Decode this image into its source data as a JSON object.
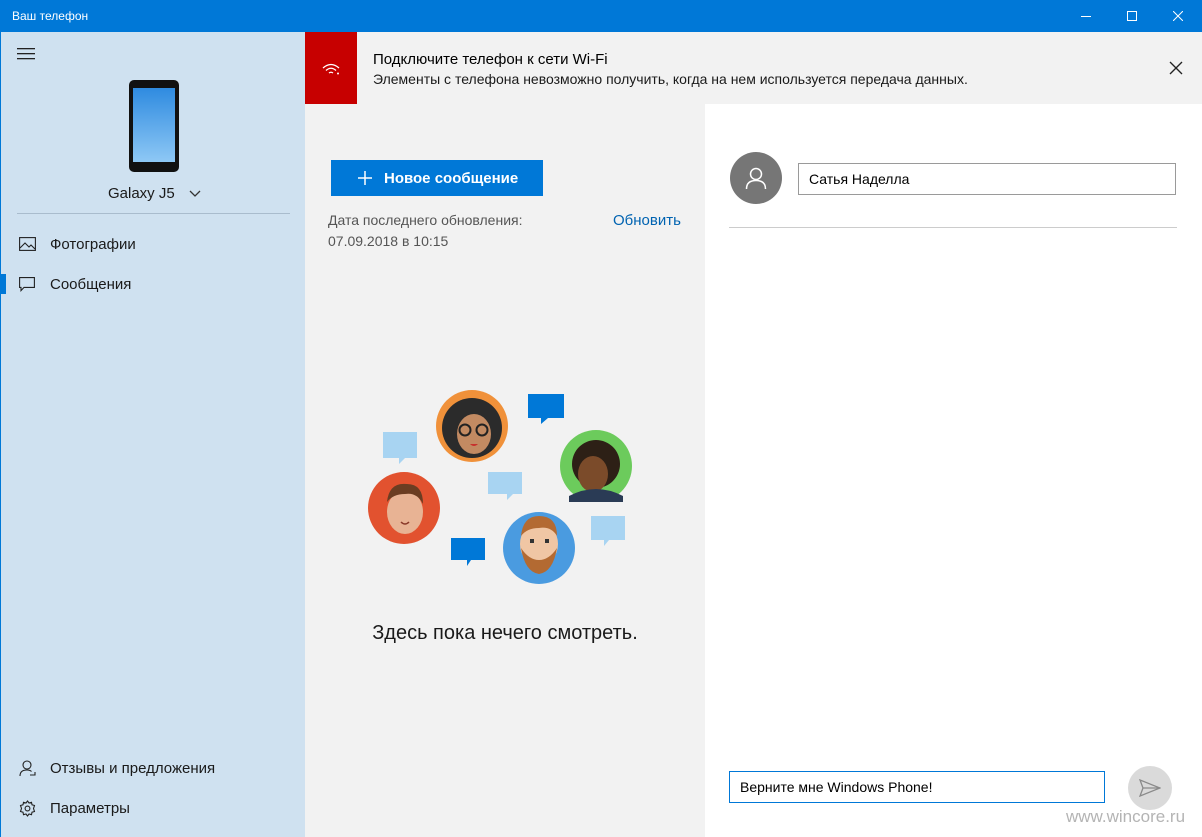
{
  "window": {
    "title": "Ваш телефон"
  },
  "sidebar": {
    "device_name": "Galaxy J5",
    "items": [
      {
        "label": "Фотографии",
        "icon": "photos-icon"
      },
      {
        "label": "Сообщения",
        "icon": "messages-icon",
        "active": true
      }
    ],
    "bottom_items": [
      {
        "label": "Отзывы и предложения",
        "icon": "feedback-icon"
      },
      {
        "label": "Параметры",
        "icon": "settings-icon"
      }
    ]
  },
  "banner": {
    "title": "Подключите телефон к сети Wi-Fi",
    "text": "Элементы с телефона невозможно получить, когда на нем используется передача данных.",
    "icon": "wifi-warning-icon",
    "color": "#c70000"
  },
  "messages": {
    "new_message_label": "Новое сообщение",
    "updated_label": "Дата последнего обновления:",
    "updated_time": "07.09.2018 в 10:15",
    "refresh_label": "Обновить",
    "empty_text": "Здесь пока нечего смотреть."
  },
  "conversation": {
    "recipient_value": "Сатья Наделла",
    "compose_value": "Верните мне Windows Phone!",
    "send_icon": "send-icon"
  },
  "watermark": "www.wincore.ru",
  "colors": {
    "accent": "#0078d7",
    "sidebar_bg": "#cfe1f0",
    "link": "#0063b1"
  }
}
